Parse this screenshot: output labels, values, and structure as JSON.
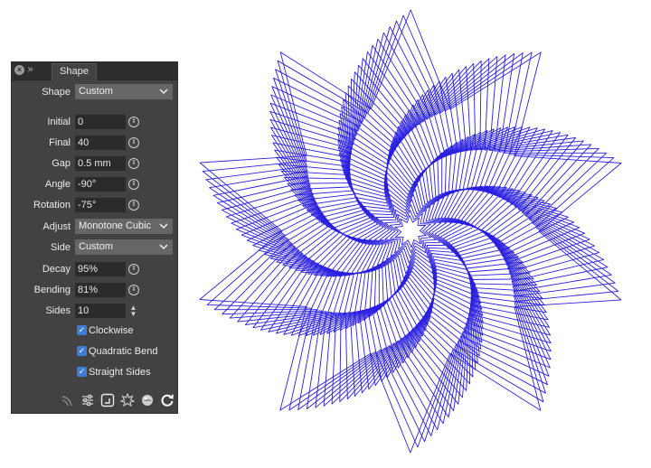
{
  "panel": {
    "tab_title": "Shape",
    "shape": {
      "label": "Shape",
      "value": "Custom"
    },
    "fields": [
      {
        "label": "Initial",
        "value": "0"
      },
      {
        "label": "Final",
        "value": "40"
      },
      {
        "label": "Gap",
        "value": "0.5 mm"
      },
      {
        "label": "Angle",
        "value": "-90°"
      },
      {
        "label": "Rotation",
        "value": "-75°"
      }
    ],
    "adjust": {
      "label": "Adjust",
      "value": "Monotone Cubic"
    },
    "side": {
      "label": "Side",
      "value": "Custom"
    },
    "decay": {
      "label": "Decay",
      "value": "95%"
    },
    "bending": {
      "label": "Bending",
      "value": "81%"
    },
    "sides": {
      "label": "Sides",
      "value": "10"
    },
    "checkboxes": [
      {
        "label": "Clockwise",
        "checked": true
      },
      {
        "label": "Quadratic Bend",
        "checked": true
      },
      {
        "label": "Straight Sides",
        "checked": true
      }
    ],
    "footer_icons": [
      "arc-icon",
      "sliders-icon",
      "corner-frame-icon",
      "gear-burst-icon",
      "sphere-icon",
      "refresh-icon"
    ]
  },
  "artwork": {
    "stroke_color": "#2a1fe0",
    "sides": 10,
    "rings": 40
  }
}
